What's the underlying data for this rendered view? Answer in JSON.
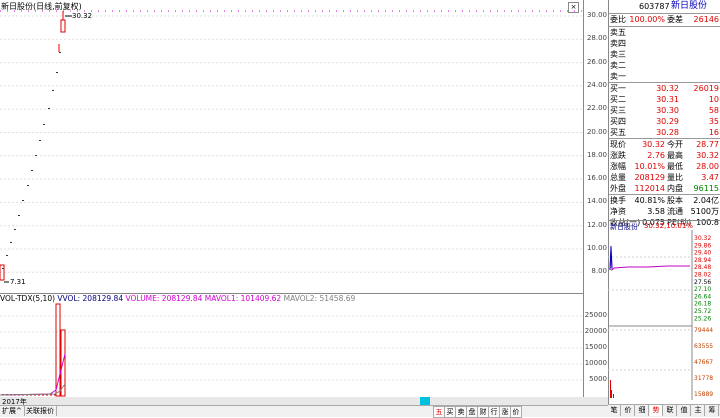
{
  "kline": {
    "title": "新日股份(日线,前复权)",
    "high_label": "30.32",
    "low_label": "7.31",
    "y_ticks": [
      "30.00",
      "28.00",
      "26.00",
      "24.00",
      "22.00",
      "20.00",
      "18.00",
      "16.00",
      "14.00",
      "12.00",
      "10.00",
      "8.00"
    ]
  },
  "volume": {
    "indicator": "VOL-TDX(5,10)",
    "vvol": "VVOL: 208129.84",
    "vol": "VOLUME: 208129.84",
    "mavol1": "MAVOL1: 101409.62",
    "mavol2": "MAVOL2: 51458.69",
    "y_ticks": [
      "25000",
      "20000",
      "15000",
      "10000",
      "5000"
    ]
  },
  "status_bar": {
    "year": "2017年"
  },
  "bottom_tabs": [
    "扩展^",
    "关联报价"
  ],
  "tool_icons": [
    "五",
    "买",
    "卖",
    "盘",
    "财",
    "行",
    "涨",
    "价"
  ],
  "quote": {
    "code": "603787",
    "name": "新日股份",
    "weibi_label": "委比",
    "weibi_value": "100.00%",
    "weicha_label": "委差",
    "weicha_value": "26146",
    "sell": [
      {
        "label": "卖五",
        "price": "",
        "vol": ""
      },
      {
        "label": "卖四",
        "price": "",
        "vol": ""
      },
      {
        "label": "卖三",
        "price": "",
        "vol": ""
      },
      {
        "label": "卖二",
        "price": "",
        "vol": ""
      },
      {
        "label": "卖一",
        "price": "",
        "vol": ""
      }
    ],
    "buy": [
      {
        "label": "买一",
        "price": "30.32",
        "vol": "26019"
      },
      {
        "label": "买二",
        "price": "30.31",
        "vol": "10"
      },
      {
        "label": "买三",
        "price": "30.30",
        "vol": "58"
      },
      {
        "label": "买四",
        "price": "30.29",
        "vol": "35"
      },
      {
        "label": "买五",
        "price": "30.28",
        "vol": "16"
      }
    ],
    "stats": [
      {
        "l1": "现价",
        "v1": "30.32",
        "c1": "red",
        "l2": "今开",
        "v2": "28.77",
        "c2": "red"
      },
      {
        "l1": "涨跌",
        "v1": "2.76",
        "c1": "red",
        "l2": "最高",
        "v2": "30.32",
        "c2": "red"
      },
      {
        "l1": "涨幅",
        "v1": "10.01%",
        "c1": "red",
        "l2": "最低",
        "v2": "28.00",
        "c2": "red"
      },
      {
        "l1": "总量",
        "v1": "208129",
        "c1": "red",
        "l2": "量比",
        "v2": "3.47",
        "c2": "red"
      },
      {
        "l1": "外盘",
        "v1": "112014",
        "c1": "red",
        "l2": "内盘",
        "v2": "96115",
        "c2": "green"
      }
    ],
    "fin": [
      {
        "l1": "换手",
        "v1": "40.81%",
        "l2": "股本",
        "v2": "2.04亿"
      },
      {
        "l1": "净资",
        "v1": "3.58",
        "l2": "流通",
        "v2": "5100万"
      },
      {
        "l1": "收益(一)",
        "v1": "0.075",
        "l2": "PE(动)",
        "v2": "100.8"
      }
    ]
  },
  "mini": {
    "title": "新日股份",
    "value": "30.32,10.01%",
    "price_ticks": [
      "30.32",
      "29.86",
      "29.40",
      "28.94",
      "28.48",
      "28.02",
      "27.56",
      "27.10",
      "26.64",
      "26.18",
      "25.72",
      "25.26"
    ],
    "vol_ticks": [
      "79444",
      "63555",
      "47667",
      "31778",
      "15889"
    ],
    "tabs": [
      "笔",
      "价",
      "细",
      "势",
      "联",
      "值",
      "主",
      "筹"
    ]
  }
}
